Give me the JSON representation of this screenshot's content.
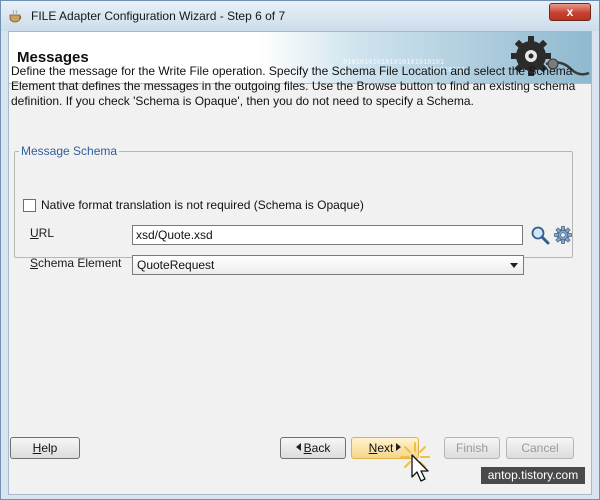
{
  "window": {
    "title": "FILE Adapter Configuration Wizard - Step 6 of 7",
    "close_label": "x"
  },
  "header": {
    "title": "Messages",
    "binary_text": "010101010101010101010101",
    "binary_text2": "0101010101"
  },
  "description": "Define the message for the Write File operation.  Specify the Schema File Location and select the Schema Element that defines the messages in the outgoing files. Use the Browse button to find an existing schema definition. If you check 'Schema is Opaque', then you do not need to specify a Schema.",
  "message_schema": {
    "legend": "Message Schema",
    "opaque_checkbox": {
      "label": "Native format translation is not required (Schema is Opaque)",
      "checked": false
    },
    "url": {
      "label_first": "U",
      "label_rest": "RL",
      "value": "xsd/Quote.xsd"
    },
    "schema_element": {
      "label_first": "S",
      "label_rest": "chema Element",
      "selected": "QuoteRequest"
    }
  },
  "buttons": {
    "help_first": "H",
    "help_rest": "elp",
    "back_first": "B",
    "back_rest": "ack",
    "next_first": "N",
    "next_rest": "ext",
    "finish": "Finish",
    "cancel": "Cancel"
  },
  "watermark": "antop.tistory.com",
  "colors": {
    "legend": "#2f5f9b",
    "next_button": "#f5d58a",
    "title_bar": "#cddceb",
    "close_button": "#c84232"
  }
}
